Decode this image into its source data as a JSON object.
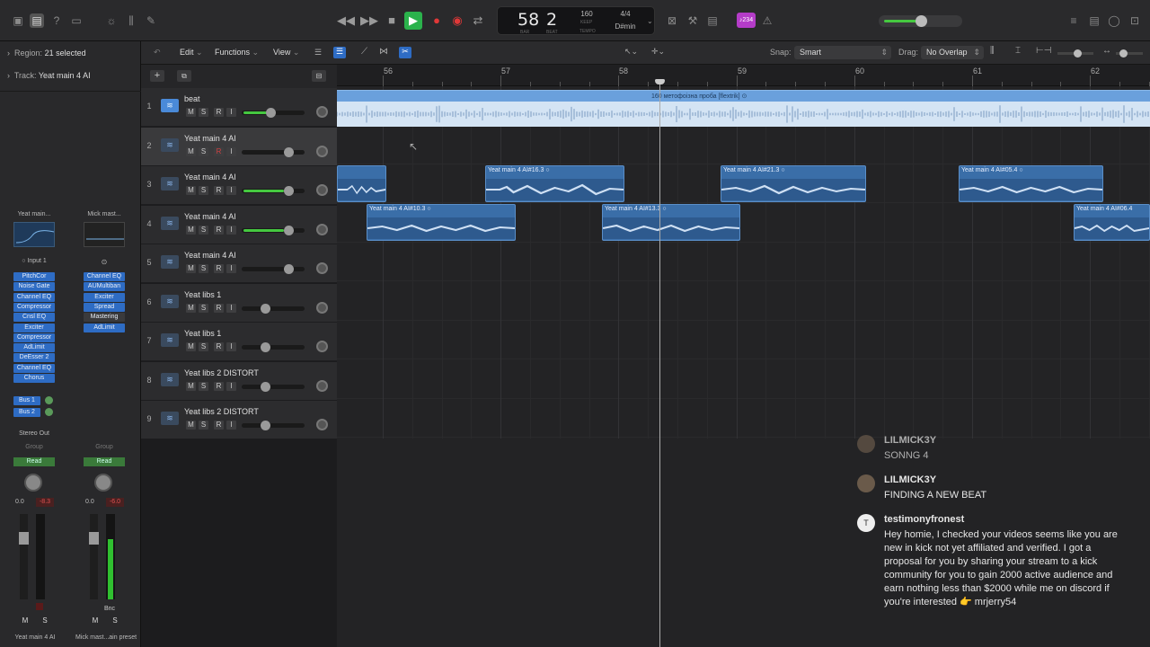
{
  "toolbar": {
    "icons": [
      "library-icon",
      "inspector-icon",
      "quick-help-icon",
      "toolbar-icon",
      "smart-controls-icon",
      "mixer-icon",
      "editors-icon"
    ],
    "transport": {
      "rewind_icon": "◀◀",
      "forward_icon": "▶▶",
      "stop_icon": "■",
      "play_icon": "▶",
      "record_icon": "●",
      "replace_icon": "◉",
      "cycle_icon": "⇄"
    },
    "lcd": {
      "bar": "58",
      "beat": "2",
      "bar_label": "BAR",
      "beat_label": "BEAT",
      "tempo": "160",
      "tempo_label_keep": "KEEP",
      "tempo_label": "TEMPO",
      "signature": "4/4",
      "key": "D#min"
    },
    "counter_badge": "♪234",
    "master_volume_level": 0.55
  },
  "inspector": {
    "region_label": "Region:",
    "region_value": "21 selected",
    "track_label": "Track:",
    "track_value": "Yeat main 4 AI",
    "strip1": {
      "name": "Yeat main...",
      "input": "Input 1",
      "plugins": [
        "PitchCor",
        "Noise Gate",
        "Channel EQ",
        "Compressor",
        "Cnsl EQ",
        "Exciter",
        "Compressor",
        "AdLimit",
        "DeEsser 2",
        "Channel EQ",
        "Chorus"
      ],
      "sends": [
        "Bus 1",
        "Bus 2"
      ],
      "output": "Stereo Out",
      "group": "Group",
      "automation": "Read",
      "vol": "0.0",
      "peak": "-8.3",
      "footer": "Yeat main 4 AI"
    },
    "strip2": {
      "name": "Mick mast...",
      "plugins": [
        "Channel EQ",
        "AUMultiban",
        "Exciter",
        "Spread",
        "Mastering",
        "AdLimit"
      ],
      "group": "Group",
      "automation": "Read",
      "vol": "0.0",
      "peak": "-6.0",
      "bnc": "Bnc",
      "footer": "Mick mast...ain preset"
    }
  },
  "editbar": {
    "edit": "Edit",
    "functions": "Functions",
    "view": "View",
    "snap_label": "Snap:",
    "snap_value": "Smart",
    "drag_label": "Drag:",
    "drag_value": "No Overlap"
  },
  "ruler": {
    "bars": [
      "56",
      "57",
      "58",
      "59",
      "60",
      "61",
      "62"
    ]
  },
  "tracks": [
    {
      "num": "1",
      "name": "beat",
      "m": "M",
      "s": "S",
      "r": "R",
      "i": "I"
    },
    {
      "num": "2",
      "name": "Yeat main 4 AI",
      "m": "M",
      "s": "S",
      "r": "R",
      "i": "I"
    },
    {
      "num": "3",
      "name": "Yeat main 4 AI",
      "m": "M",
      "s": "S",
      "r": "R",
      "i": "I"
    },
    {
      "num": "4",
      "name": "Yeat main 4 AI",
      "m": "M",
      "s": "S",
      "r": "R",
      "i": "I"
    },
    {
      "num": "5",
      "name": "Yeat main 4 AI",
      "m": "M",
      "s": "S",
      "r": "R",
      "i": "I"
    },
    {
      "num": "6",
      "name": "Yeat libs 1",
      "m": "M",
      "s": "S",
      "r": "R",
      "i": "I"
    },
    {
      "num": "7",
      "name": "Yeat libs 1",
      "m": "M",
      "s": "S",
      "r": "R",
      "i": "I"
    },
    {
      "num": "8",
      "name": "Yeat libs 2 DISTORT",
      "m": "M",
      "s": "S",
      "r": "R",
      "i": "I"
    },
    {
      "num": "9",
      "name": "Yeat libs 2 DISTORT",
      "m": "M",
      "s": "S",
      "r": "R",
      "i": "I"
    }
  ],
  "regions": {
    "beat": "160 метофоізна проба [flextrik] ⊙",
    "r3a": "Yeat main 4 AI#16.3 ○",
    "r3b": "Yeat main 4 AI#21.3 ○",
    "r3c": "Yeat main 4 AI#05.4 ○",
    "r4a": "Yeat main 4 AI#10.3 ○",
    "r4b": "Yeat main 4 AI#13.3 ○",
    "r4c": "Yeat main 4 AI#06.4"
  },
  "chat": [
    {
      "user": "LILMICK3Y",
      "text": "SONNG 4"
    },
    {
      "user": "LILMICK3Y",
      "text": "FINDING A NEW BEAT"
    },
    {
      "user": "testimonyfronest",
      "avatar": "T",
      "text": "Hey homie, I checked your videos seems like you are new in kick not yet affiliated and verified. I got a proposal for you by sharing your stream to a kick community for you to gain 2000 active audience and earn nothing less than $2000 while me on discord if you're interested 👉 mrjerry54"
    }
  ]
}
